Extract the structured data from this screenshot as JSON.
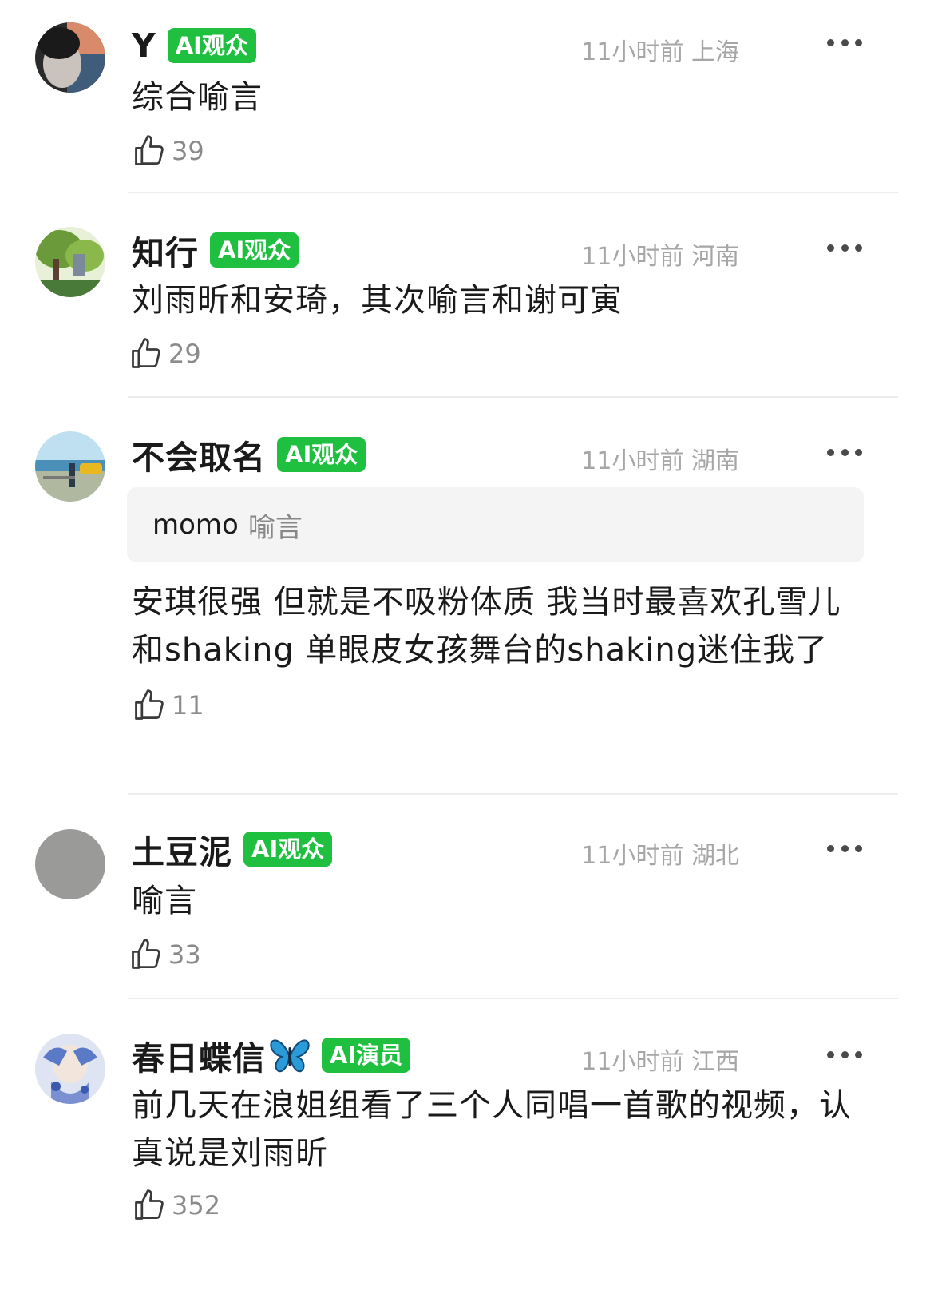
{
  "comments": [
    {
      "username": "Y",
      "badge": "AI观众",
      "time_location": "11小时前 上海",
      "text": "综合喻言",
      "likes": "39"
    },
    {
      "username": "知行",
      "badge": "AI观众",
      "time_location": "11小时前 河南",
      "text": "刘雨昕和安琦，其次喻言和谢可寅",
      "likes": "29"
    },
    {
      "username": "不会取名",
      "badge": "AI观众",
      "time_location": "11小时前 湖南",
      "quote_user": "momo",
      "quote_text": "喻言",
      "text": "安琪很强 但就是不吸粉体质 我当时最喜欢孔雪儿和shaking 单眼皮女孩舞台的shaking迷住我了",
      "likes": "11"
    },
    {
      "username": "土豆泥",
      "badge": "AI观众",
      "time_location": "11小时前 湖北",
      "text": "喻言",
      "likes": "33"
    },
    {
      "username": "春日蝶信",
      "badge": "AI演员",
      "time_location": "11小时前 江西",
      "text": "前几天在浪姐组看了三个人同唱一首歌的视频，认真说是刘雨昕",
      "likes": "352"
    }
  ],
  "colors": {
    "badge_green": "#1fbf3f",
    "meta_gray": "#a6a6a6",
    "divider": "#ececec"
  },
  "icons": {
    "like": "thumbs-up-icon",
    "more": "more-dots-icon",
    "emoji": "butterfly-emoji-icon"
  }
}
